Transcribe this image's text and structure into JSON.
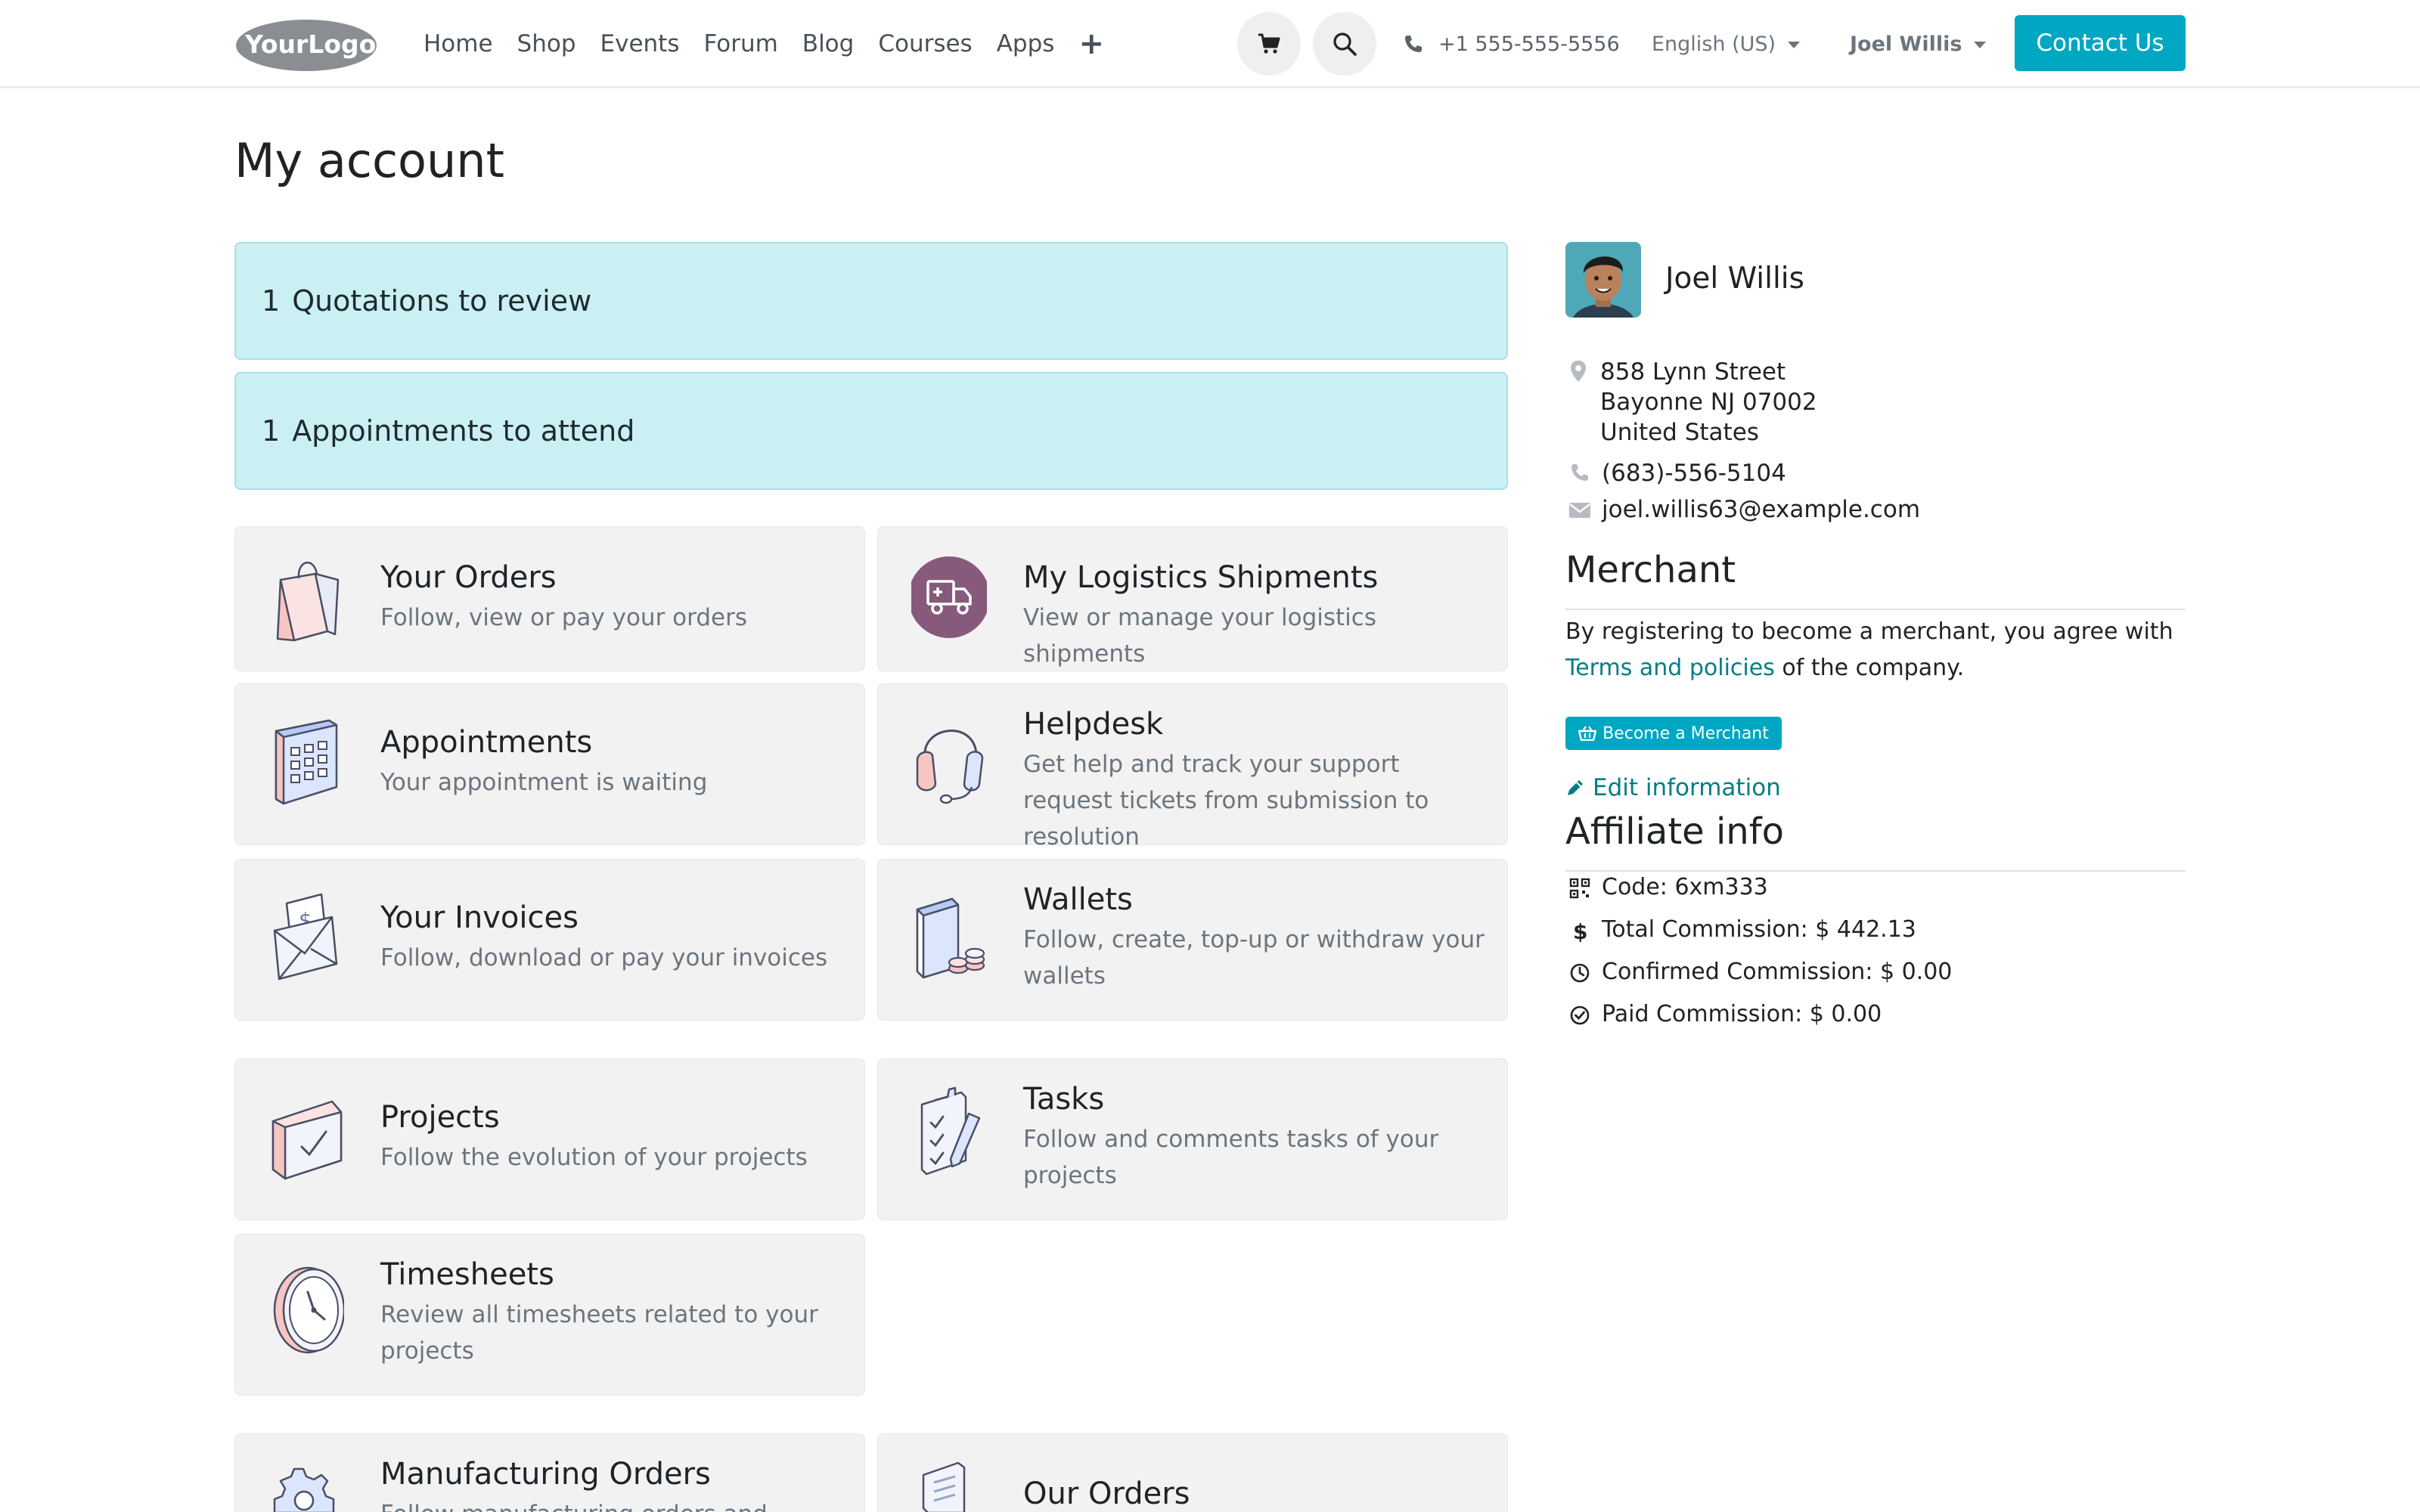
{
  "navbar": {
    "logo_text": "YourLogo",
    "links": [
      "Home",
      "Shop",
      "Events",
      "Forum",
      "Blog",
      "Courses",
      "Apps"
    ],
    "plus_icon": "plus-icon",
    "cart_icon": "shopping-cart-icon",
    "search_icon": "search-icon",
    "phone": "+1 555-555-5556",
    "language": "English (US)",
    "user": "Joel Willis",
    "contact_label": "Contact Us",
    "accent_color": "#00a7c2"
  },
  "page": {
    "title": "My account"
  },
  "alerts": [
    {
      "count": "1",
      "label": "Quotations to review"
    },
    {
      "count": "1",
      "label": "Appointments to attend"
    }
  ],
  "cards": [
    {
      "title": "Your Orders",
      "desc": "Follow, view or pay your orders",
      "icon": "shopping-bag-icon"
    },
    {
      "title": "My Logistics Shipments",
      "desc": "View or manage your logistics shipments",
      "icon": "delivery-truck-icon"
    },
    {
      "title": "Appointments",
      "desc": "Your appointment is waiting",
      "icon": "calendar-icon"
    },
    {
      "title": "Helpdesk",
      "desc": "Get help and track your support request tickets from submission to resolution",
      "icon": "headset-icon"
    },
    {
      "title": "Your Invoices",
      "desc": "Follow, download or pay your invoices",
      "icon": "invoice-envelope-icon"
    },
    {
      "title": "Wallets",
      "desc": "Follow, create, top-up or withdraw your wallets",
      "icon": "wallet-coins-icon"
    },
    {
      "title": "Projects",
      "desc": "Follow the evolution of your projects",
      "icon": "project-folder-icon"
    },
    {
      "title": "Tasks",
      "desc": "Follow and comments tasks of your projects",
      "icon": "task-checklist-icon"
    },
    {
      "title": "Timesheets",
      "desc": "Review all timesheets related to your projects",
      "icon": "clock-icon"
    },
    {
      "title": "Manufacturing Orders",
      "desc": "Follow manufacturing orders and production",
      "icon": "gear-icon"
    },
    {
      "title": "Our Orders",
      "desc": "",
      "icon": "order-sheet-icon"
    }
  ],
  "profile": {
    "name": "Joel Willis",
    "address": [
      "858 Lynn Street",
      "Bayonne NJ 07002",
      "United States"
    ],
    "phone": "(683)-556-5104",
    "email": "joel.willis63@example.com"
  },
  "merchant": {
    "heading": "Merchant",
    "text_before": "By registering to become a merchant, you agree with ",
    "link_text": "Terms and policies",
    "text_after": " of the company.",
    "button_label": "Become a Merchant",
    "edit_label": "Edit information"
  },
  "affiliate": {
    "heading": "Affiliate info",
    "rows": [
      {
        "label": "Code: 6xm333",
        "icon": "qrcode-icon"
      },
      {
        "label": "Total Commission: $ 442.13",
        "icon": "dollar-icon"
      },
      {
        "label": "Confirmed Commission: $ 0.00",
        "icon": "clock-circle-icon"
      },
      {
        "label": "Paid Commission: $ 0.00",
        "icon": "check-circle-icon"
      }
    ]
  }
}
